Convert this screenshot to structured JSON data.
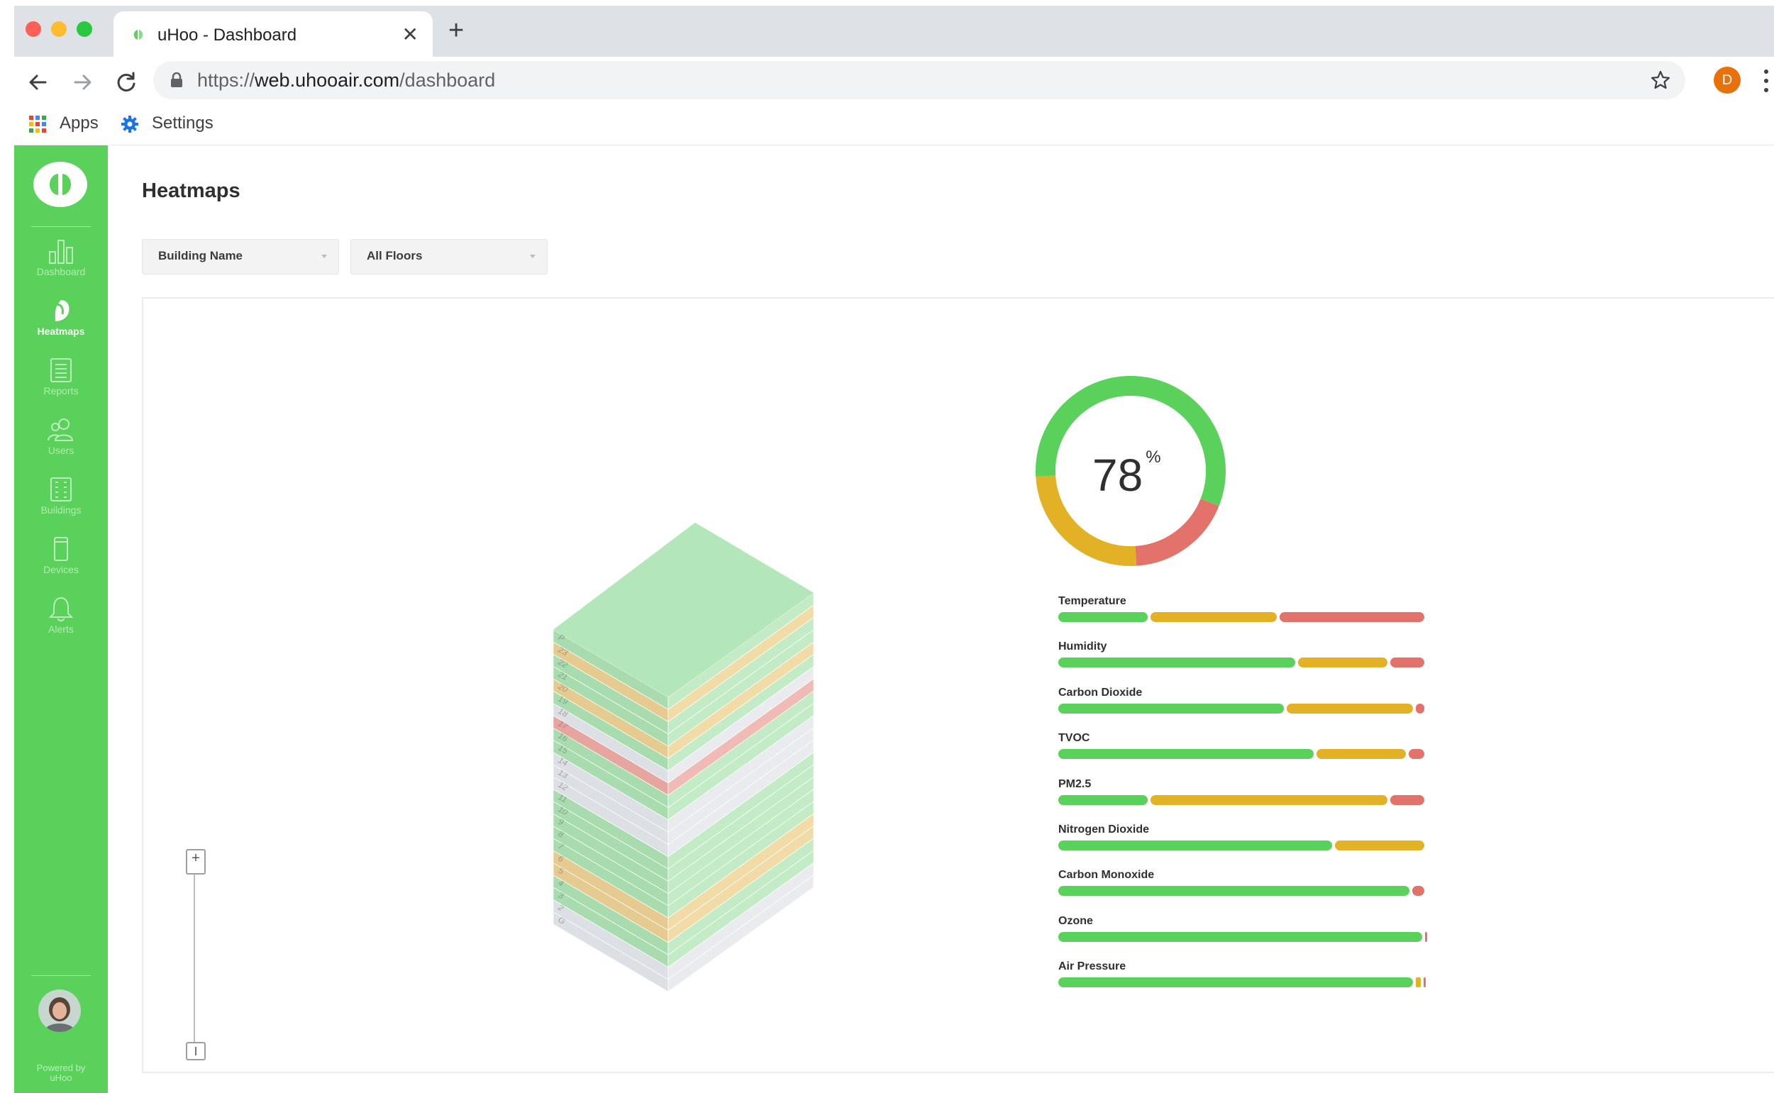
{
  "browser": {
    "tab_title": "uHoo - Dashboard",
    "url_scheme": "https://",
    "url_host": "web.uhooair.com",
    "url_path": "/dashboard",
    "profile_initial": "D",
    "bookmarks": {
      "apps": "Apps",
      "settings": "Settings"
    }
  },
  "sidebar": {
    "items": [
      {
        "label": "Dashboard",
        "icon": "bar-chart-icon",
        "active": false
      },
      {
        "label": "Heatmaps",
        "icon": "heatmap-icon",
        "active": true
      },
      {
        "label": "Reports",
        "icon": "reports-icon",
        "active": false
      },
      {
        "label": "Users",
        "icon": "users-icon",
        "active": false
      },
      {
        "label": "Buildings",
        "icon": "buildings-icon",
        "active": false
      },
      {
        "label": "Devices",
        "icon": "device-icon",
        "active": false
      },
      {
        "label": "Alerts",
        "icon": "bell-icon",
        "active": false
      }
    ],
    "powered_line1": "Powered by",
    "powered_line2": "uHoo"
  },
  "main": {
    "title": "Heatmaps",
    "filters": {
      "building": "Building Name",
      "floors": "All Floors"
    }
  },
  "colors": {
    "good": "#5ad15a",
    "moderate": "#e2b126",
    "bad": "#e3736a",
    "inactive": "#d8dbe0",
    "sidebar": "#5ad15a"
  },
  "building": {
    "floors_bottom_to_top": [
      {
        "label": "G",
        "status": "inactive"
      },
      {
        "label": "2",
        "status": "inactive"
      },
      {
        "label": "3",
        "status": "good"
      },
      {
        "label": "4",
        "status": "good"
      },
      {
        "label": "5",
        "status": "moderate"
      },
      {
        "label": "6",
        "status": "moderate"
      },
      {
        "label": "7",
        "status": "good"
      },
      {
        "label": "8",
        "status": "good"
      },
      {
        "label": "9",
        "status": "good"
      },
      {
        "label": "10",
        "status": "good"
      },
      {
        "label": "11",
        "status": "good"
      },
      {
        "label": "12",
        "status": "inactive"
      },
      {
        "label": "13",
        "status": "inactive"
      },
      {
        "label": "14",
        "status": "inactive"
      },
      {
        "label": "15",
        "status": "good"
      },
      {
        "label": "16",
        "status": "good"
      },
      {
        "label": "17",
        "status": "bad"
      },
      {
        "label": "18",
        "status": "inactive"
      },
      {
        "label": "19",
        "status": "good"
      },
      {
        "label": "20",
        "status": "moderate"
      },
      {
        "label": "21",
        "status": "good"
      },
      {
        "label": "22",
        "status": "good"
      },
      {
        "label": "23",
        "status": "moderate"
      },
      {
        "label": "P",
        "status": "good"
      }
    ]
  },
  "score": {
    "value": "78",
    "unit": "%",
    "good_fraction": 0.57,
    "moderate_fraction": 0.25,
    "bad_fraction": 0.18
  },
  "metrics": [
    {
      "name": "Temperature",
      "good": 0.25,
      "moderate": 0.35,
      "bad": 0.4
    },
    {
      "name": "Humidity",
      "good": 0.65,
      "moderate": 0.25,
      "bad": 0.1
    },
    {
      "name": "Carbon Dioxide",
      "good": 0.62,
      "moderate": 0.35,
      "bad": 0.03
    },
    {
      "name": "TVOC",
      "good": 0.7,
      "moderate": 0.25,
      "bad": 0.05
    },
    {
      "name": "PM2.5",
      "good": 0.25,
      "moderate": 0.65,
      "bad": 0.1
    },
    {
      "name": "Nitrogen Dioxide",
      "good": 0.75,
      "moderate": 0.25,
      "bad": 0
    },
    {
      "name": "Carbon Monoxide",
      "good": 0.96,
      "moderate": 0,
      "bad": 0.04
    },
    {
      "name": "Ozone",
      "good": 0.995,
      "moderate": 0,
      "bad": 0.005
    },
    {
      "name": "Air Pressure",
      "good": 0.97,
      "moderate": 0.02,
      "bad": 0.01
    }
  ]
}
